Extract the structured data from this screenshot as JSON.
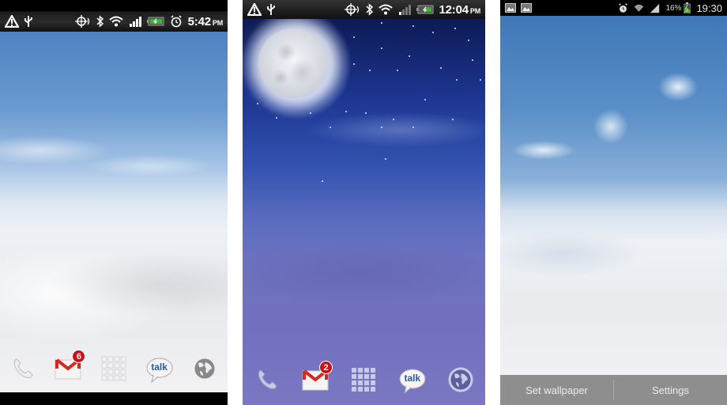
{
  "screens": [
    {
      "id": "htc-day",
      "statusbar": {
        "left_icons": [
          "warning-icon",
          "usb-icon"
        ],
        "right_icons": [
          "gps-icon",
          "bluetooth-icon",
          "wifi-icon",
          "signal-icon",
          "battery-charging-icon",
          "alarm-icon"
        ],
        "time": "5:42",
        "ampm": "PM"
      },
      "dock": [
        {
          "name": "phone",
          "icon": "phone-icon"
        },
        {
          "name": "gmail",
          "icon": "gmail-icon",
          "badge": "6"
        },
        {
          "name": "app-drawer",
          "icon": "app-grid-icon"
        },
        {
          "name": "talk",
          "icon": "talk-icon",
          "label": "talk"
        },
        {
          "name": "browser",
          "icon": "globe-icon"
        }
      ]
    },
    {
      "id": "htc-night",
      "statusbar": {
        "left_icons": [
          "warning-icon",
          "usb-icon"
        ],
        "right_icons": [
          "gps-icon",
          "bluetooth-icon",
          "wifi-icon",
          "signal-icon",
          "battery-charging-icon"
        ],
        "time": "12:04",
        "ampm": "PM"
      },
      "dock": [
        {
          "name": "phone",
          "icon": "phone-icon"
        },
        {
          "name": "gmail",
          "icon": "gmail-icon",
          "badge": "2"
        },
        {
          "name": "app-drawer",
          "icon": "app-grid-icon"
        },
        {
          "name": "talk",
          "icon": "talk-icon",
          "label": "talk"
        },
        {
          "name": "browser",
          "icon": "globe-icon"
        }
      ]
    },
    {
      "id": "samsung-preview",
      "statusbar": {
        "left_icons": [
          "gallery-notification-icon",
          "gallery-notification-icon"
        ],
        "right_icons": [
          "alarm-icon",
          "wifi-icon",
          "signal-icon",
          "battery-charging-icon"
        ],
        "battery_percent": "16%",
        "time": "19:30"
      },
      "actions": {
        "set_wallpaper": "Set wallpaper",
        "settings": "Settings"
      }
    }
  ],
  "colors": {
    "badge_red": "#c8121a",
    "day_sky": "#4f82bf",
    "night_sky": "#1c3590",
    "night_clouds": "#7270be"
  }
}
